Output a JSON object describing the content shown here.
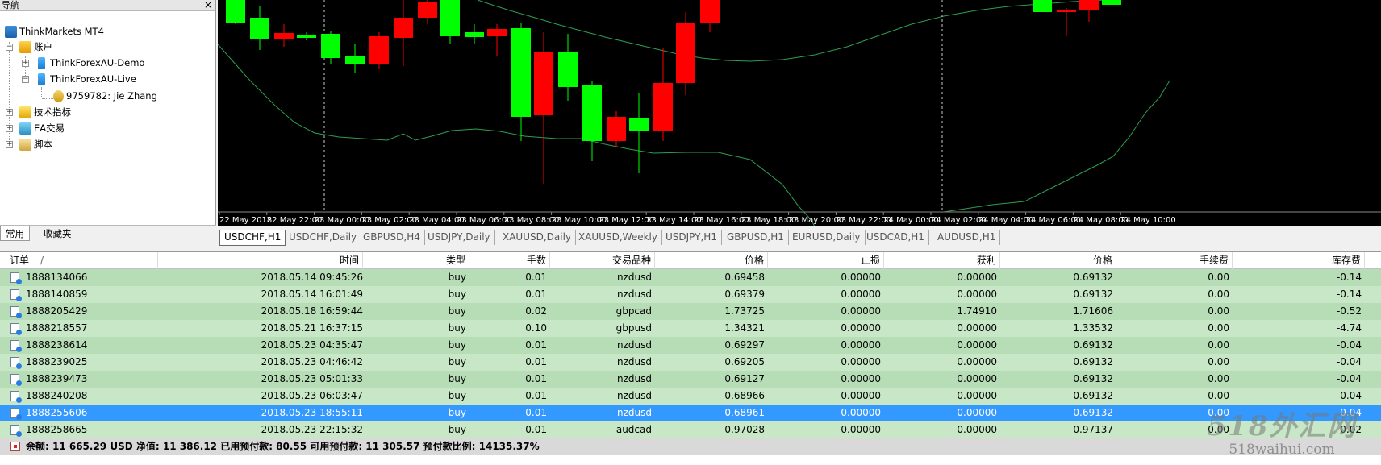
{
  "navigator": {
    "title": "导航",
    "close": "×",
    "tree": {
      "root": "ThinkMarkets MT4",
      "accounts": "账户",
      "demo": "ThinkForexAU-Demo",
      "live": "ThinkForexAU-Live",
      "user": "9759782: Jie Zhang",
      "indicators": "技术指标",
      "ea": "EA交易",
      "scripts": "脚本"
    },
    "tabs": [
      "常用",
      "收藏夹"
    ]
  },
  "chart": {
    "time_labels": [
      "22 May 2018",
      "22 May 22:00",
      "23 May 00:00",
      "23 May 02:00",
      "23 May 04:00",
      "23 May 06:00",
      "23 May 08:00",
      "23 May 10:00",
      "23 May 12:00",
      "23 May 14:00",
      "23 May 16:00",
      "23 May 18:00",
      "23 May 20:00",
      "23 May 22:00",
      "24 May 00:00",
      "24 May 02:00",
      "24 May 04:00",
      "24 May 06:00",
      "24 May 08:00",
      "24 May 10:00"
    ],
    "colors": {
      "bull": "#00ff00",
      "bear": "#ff0000",
      "band": "#2e9e52",
      "background": "#000000"
    }
  },
  "chart_tabs": [
    "USDCHF,H1",
    "USDCHF,Daily",
    "GBPUSD,H4",
    "USDJPY,Daily",
    "XAUUSD,Daily",
    "XAUUSD,Weekly",
    "USDJPY,H1",
    "GBPUSD,H1",
    "EURUSD,Daily",
    "USDCAD,H1",
    "AUDUSD,H1"
  ],
  "terminal": {
    "columns": {
      "order": "订单",
      "sort": "/",
      "time": "时间",
      "type": "类型",
      "lots": "手数",
      "symbol": "交易品种",
      "price": "价格",
      "sl": "止损",
      "tp": "获利",
      "cur_price": "价格",
      "commission": "手续费",
      "swap": "库存费"
    },
    "rows": [
      {
        "order": "1888134066",
        "time": "2018.05.14 09:45:26",
        "type": "buy",
        "lots": "0.01",
        "symbol": "nzdusd",
        "price": "0.69458",
        "sl": "0.00000",
        "tp": "0.00000",
        "cur": "0.69132",
        "commission": "0.00",
        "swap": "-0.14"
      },
      {
        "order": "1888140859",
        "time": "2018.05.14 16:01:49",
        "type": "buy",
        "lots": "0.01",
        "symbol": "nzdusd",
        "price": "0.69379",
        "sl": "0.00000",
        "tp": "0.00000",
        "cur": "0.69132",
        "commission": "0.00",
        "swap": "-0.14"
      },
      {
        "order": "1888205429",
        "time": "2018.05.18 16:59:44",
        "type": "buy",
        "lots": "0.02",
        "symbol": "gbpcad",
        "price": "1.73725",
        "sl": "0.00000",
        "tp": "1.74910",
        "cur": "1.71606",
        "commission": "0.00",
        "swap": "-0.52"
      },
      {
        "order": "1888218557",
        "time": "2018.05.21 16:37:15",
        "type": "buy",
        "lots": "0.10",
        "symbol": "gbpusd",
        "price": "1.34321",
        "sl": "0.00000",
        "tp": "0.00000",
        "cur": "1.33532",
        "commission": "0.00",
        "swap": "-4.74"
      },
      {
        "order": "1888238614",
        "time": "2018.05.23 04:35:47",
        "type": "buy",
        "lots": "0.01",
        "symbol": "nzdusd",
        "price": "0.69297",
        "sl": "0.00000",
        "tp": "0.00000",
        "cur": "0.69132",
        "commission": "0.00",
        "swap": "-0.04"
      },
      {
        "order": "1888239025",
        "time": "2018.05.23 04:46:42",
        "type": "buy",
        "lots": "0.01",
        "symbol": "nzdusd",
        "price": "0.69205",
        "sl": "0.00000",
        "tp": "0.00000",
        "cur": "0.69132",
        "commission": "0.00",
        "swap": "-0.04"
      },
      {
        "order": "1888239473",
        "time": "2018.05.23 05:01:33",
        "type": "buy",
        "lots": "0.01",
        "symbol": "nzdusd",
        "price": "0.69127",
        "sl": "0.00000",
        "tp": "0.00000",
        "cur": "0.69132",
        "commission": "0.00",
        "swap": "-0.04"
      },
      {
        "order": "1888240208",
        "time": "2018.05.23 06:03:47",
        "type": "buy",
        "lots": "0.01",
        "symbol": "nzdusd",
        "price": "0.68966",
        "sl": "0.00000",
        "tp": "0.00000",
        "cur": "0.69132",
        "commission": "0.00",
        "swap": "-0.04"
      },
      {
        "order": "1888255606",
        "time": "2018.05.23 18:55:11",
        "type": "buy",
        "lots": "0.01",
        "symbol": "nzdusd",
        "price": "0.68961",
        "sl": "0.00000",
        "tp": "0.00000",
        "cur": "0.69132",
        "commission": "0.00",
        "swap": "-0.04",
        "selected": true
      },
      {
        "order": "1888258665",
        "time": "2018.05.23 22:15:32",
        "type": "buy",
        "lots": "0.01",
        "symbol": "audcad",
        "price": "0.97028",
        "sl": "0.00000",
        "tp": "0.00000",
        "cur": "0.97137",
        "commission": "0.00",
        "swap": "-0.02"
      }
    ],
    "summary": "余额: 11 665.29 USD  净值: 11 386.12  已用预付款: 80.55  可用预付款: 11 305.57  预付款比例: 14135.37%"
  },
  "watermark": {
    "big": "518外汇网",
    "small": "518waihui.com"
  }
}
